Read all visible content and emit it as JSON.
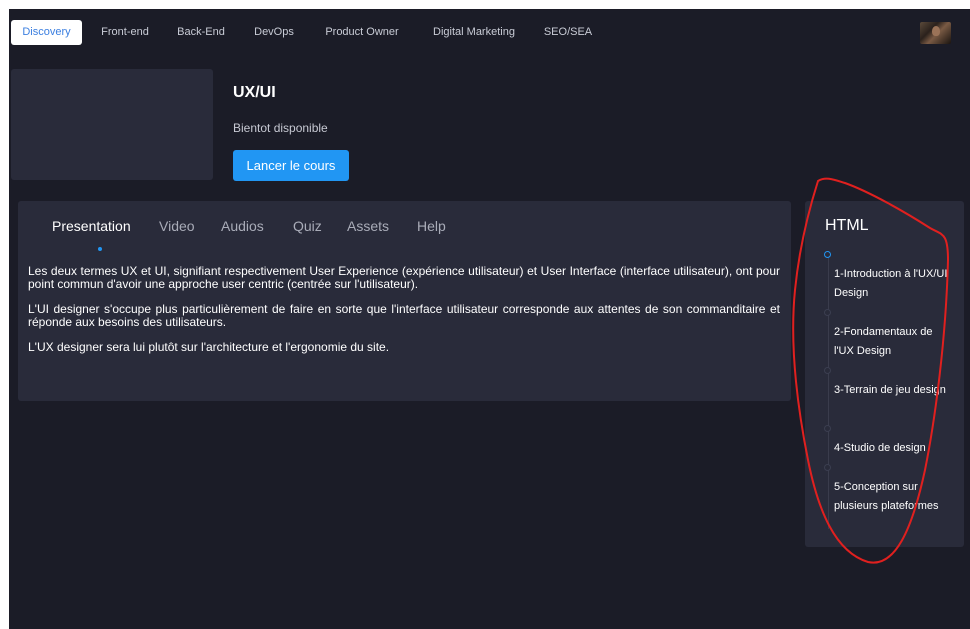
{
  "topnav": {
    "tabs": [
      {
        "label": "Discovery"
      },
      {
        "label": "Front-end"
      },
      {
        "label": "Back-End"
      },
      {
        "label": "DevOps"
      },
      {
        "label": "Product Owner"
      },
      {
        "label": "Digital Marketing"
      },
      {
        "label": "SEO/SEA"
      }
    ],
    "active_tab": "Discovery"
  },
  "course": {
    "title": "UX/UI",
    "subtitle": "Bientot disponible",
    "launch_label": "Lancer le cours"
  },
  "content": {
    "tabs": [
      {
        "label": "Presentation"
      },
      {
        "label": "Video"
      },
      {
        "label": "Audios"
      },
      {
        "label": "Quiz"
      },
      {
        "label": "Assets"
      },
      {
        "label": "Help"
      }
    ],
    "active_tab": "Presentation",
    "paragraphs": [
      "Les deux termes UX et UI, signifiant respectivement User Experience (expérience utilisateur) et User Interface (interface utilisateur), ont pour point commun d'avoir une approche user centric (centrée sur l'utilisateur).",
      "L'UI designer s'occupe plus particulièrement de faire en sorte que l'interface utilisateur corresponde aux attentes de son commanditaire et réponde aux besoins des utilisateurs.",
      "L'UX designer sera lui plutôt sur l'architecture et l'ergonomie du site."
    ]
  },
  "modules": {
    "title": "HTML",
    "lessons": [
      {
        "label": "1-Introduction à l'UX/UI Design"
      },
      {
        "label": "2-Fondamentaux de l'UX Design"
      },
      {
        "label": "3-Terrain de jeu design"
      },
      {
        "label": "4-Studio de design"
      },
      {
        "label": "5-Conception sur plusieurs plateformes"
      }
    ]
  },
  "colors": {
    "background": "#1b1c27",
    "panel": "#292b3a",
    "accent": "#2196f3",
    "annotation": "#e0201f"
  }
}
